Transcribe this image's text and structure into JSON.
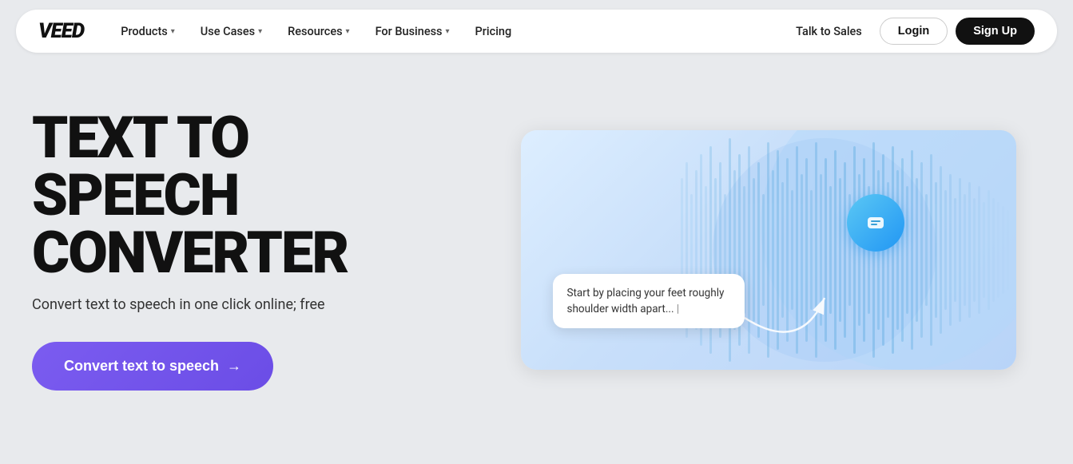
{
  "logo": "VEED",
  "nav": {
    "links": [
      {
        "label": "Products",
        "hasDropdown": true
      },
      {
        "label": "Use Cases",
        "hasDropdown": true
      },
      {
        "label": "Resources",
        "hasDropdown": true
      },
      {
        "label": "For Business",
        "hasDropdown": true
      },
      {
        "label": "Pricing",
        "hasDropdown": false
      }
    ],
    "talk_to_sales": "Talk to Sales",
    "login": "Login",
    "signup": "Sign Up"
  },
  "hero": {
    "title_line1": "TEXT TO SPEECH",
    "title_line2": "CONVERTER",
    "subtitle": "Convert text to speech in one click online; free",
    "cta_label": "Convert text to speech"
  },
  "illustration": {
    "bubble_text": "Start by placing your feet roughly shoulder width apart..."
  }
}
